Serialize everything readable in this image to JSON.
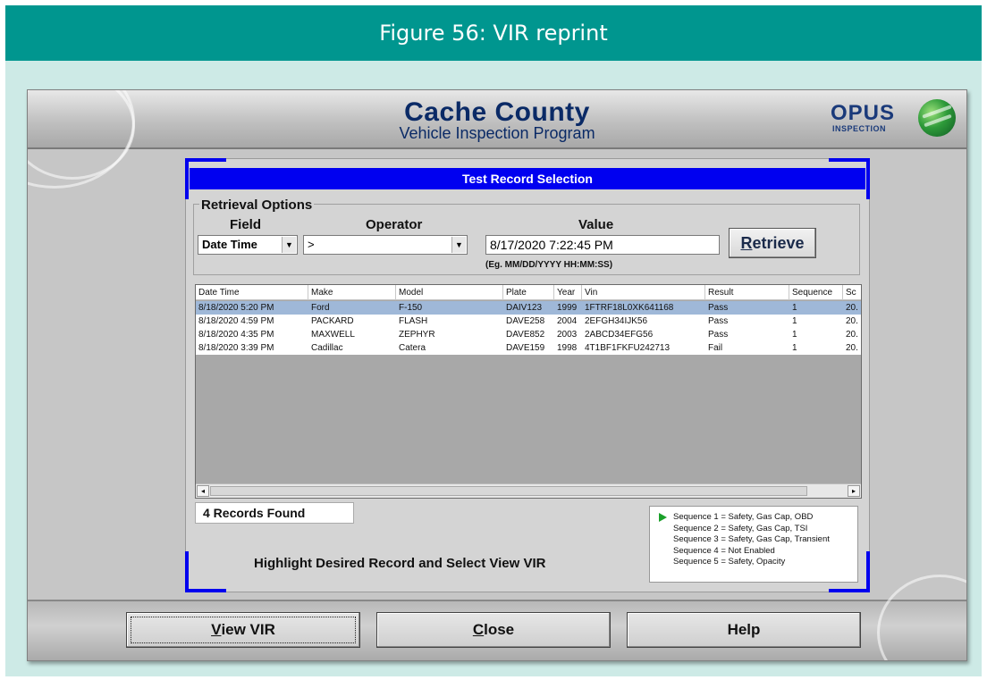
{
  "figure": {
    "caption": "Figure 56: VIR reprint"
  },
  "window": {
    "title": "Cache County",
    "subtitle": "Vehicle Inspection Program",
    "logo_text": "OPUS",
    "logo_subtext": "INSPECTION"
  },
  "panel": {
    "title": "Test Record Selection",
    "retrieval": {
      "legend": "Retrieval Options",
      "field_label": "Field",
      "operator_label": "Operator",
      "value_label": "Value",
      "field_value": "Date Time",
      "operator_value": ">",
      "value_input": "8/17/2020 7:22:45 PM",
      "value_hint": "(Eg. MM/DD/YYYY HH:MM:SS)",
      "retrieve_label_u": "R",
      "retrieve_label_rest": "etrieve"
    },
    "grid": {
      "columns": [
        "Date Time",
        "Make",
        "Model",
        "Plate",
        "Year",
        "Vin",
        "Result",
        "Sequence",
        "Sc"
      ],
      "rows": [
        [
          "8/18/2020 5:20 PM",
          "Ford",
          "F-150",
          "DAIV123",
          "1999",
          "1FTRF18L0XK641168",
          "Pass",
          "1",
          "20."
        ],
        [
          "8/18/2020 4:59 PM",
          "PACKARD",
          "FLASH",
          "DAVE258",
          "2004",
          "2EFGH34IJK56",
          "Pass",
          "1",
          "20."
        ],
        [
          "8/18/2020 4:35 PM",
          "MAXWELL",
          "ZEPHYR",
          "DAVE852",
          "2003",
          "2ABCD34EFG56",
          "Pass",
          "1",
          "20."
        ],
        [
          "8/18/2020 3:39 PM",
          "Cadillac",
          "Catera",
          "DAVE159",
          "1998",
          "4T1BF1FKFU242713",
          "Fail",
          "1",
          "20."
        ]
      ],
      "selected_row": 0,
      "scroll_left_glyph": "◂",
      "scroll_right_glyph": "▸"
    },
    "records_found": "4 Records Found",
    "instruction": "Highlight Desired Record and Select View VIR",
    "sequences": [
      "Sequence 1 = Safety, Gas Cap, OBD",
      "Sequence 2 = Safety, Gas Cap, TSI",
      "Sequence 3 = Safety, Gas Cap, Transient",
      "Sequence 4 = Not Enabled",
      "Sequence 5 = Safety, Opacity"
    ]
  },
  "buttons": {
    "view_vir_u": "V",
    "view_vir_rest": "iew VIR",
    "close_u": "C",
    "close_rest": "lose",
    "help": "Help"
  },
  "icons": {
    "dropdown": "chevron-down-icon",
    "sequence_pointer": "play-arrow-icon",
    "logo": "opus-globe-logo"
  },
  "colors": {
    "caption_bg": "#00968f",
    "frame_bg": "#cdeae6",
    "panel_title_bg": "#0000f0",
    "selected_row": "#9fb8d8",
    "pointer_green": "#1aa02a"
  }
}
